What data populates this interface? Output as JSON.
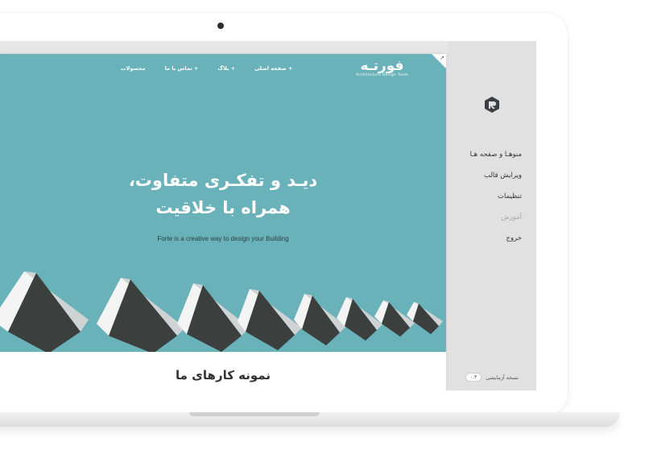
{
  "sidebar": {
    "menu": [
      {
        "label": "منوهـا و صفحه هـا",
        "disabled": false
      },
      {
        "label": "ویرایش قالب",
        "disabled": false
      },
      {
        "label": "تنظیمات",
        "disabled": false
      },
      {
        "label": "آموزش",
        "disabled": true
      },
      {
        "label": "خروج",
        "disabled": false
      }
    ],
    "version_label": "نسخه آزمایشی",
    "version_badge": "۰.۳"
  },
  "site": {
    "logo_text": "فورتـه",
    "logo_sub": "Architecture Design Team",
    "nav": [
      "+ صفحه اصلی",
      "+ بلاگ",
      "+ تماس با ما",
      "محصولات"
    ],
    "headline_line1": "دیـد و تفکـری متفاوت،",
    "headline_line2": "همراه با خلاقیت",
    "tagline": "Forte is a creative way to design your Building",
    "section_title": "نمونه کارهای ما"
  },
  "colors": {
    "hero_sky": "#69b2b9",
    "sidebar_bg": "#e1e1e1",
    "screen_bg": "#e6e6e6"
  },
  "icons": [
    "logo-icon",
    "expand-arrow-icon"
  ]
}
